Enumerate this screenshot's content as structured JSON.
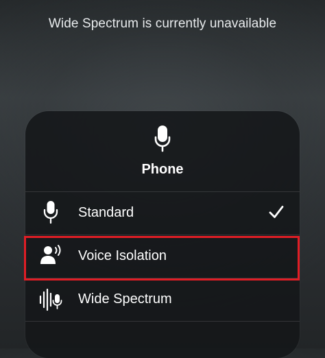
{
  "notice": {
    "text": "Wide Spectrum is currently unavailable"
  },
  "panel": {
    "title": "Phone",
    "header_icon": "microphone-icon"
  },
  "options": [
    {
      "label": "Standard",
      "icon": "microphone-icon",
      "selected": true
    },
    {
      "label": "Voice Isolation",
      "icon": "person-voice-icon",
      "selected": false,
      "highlighted": true
    },
    {
      "label": "Wide Spectrum",
      "icon": "wide-spectrum-icon",
      "selected": false
    }
  ],
  "colors": {
    "highlight": "#e11d25",
    "text": "#ffffff"
  }
}
